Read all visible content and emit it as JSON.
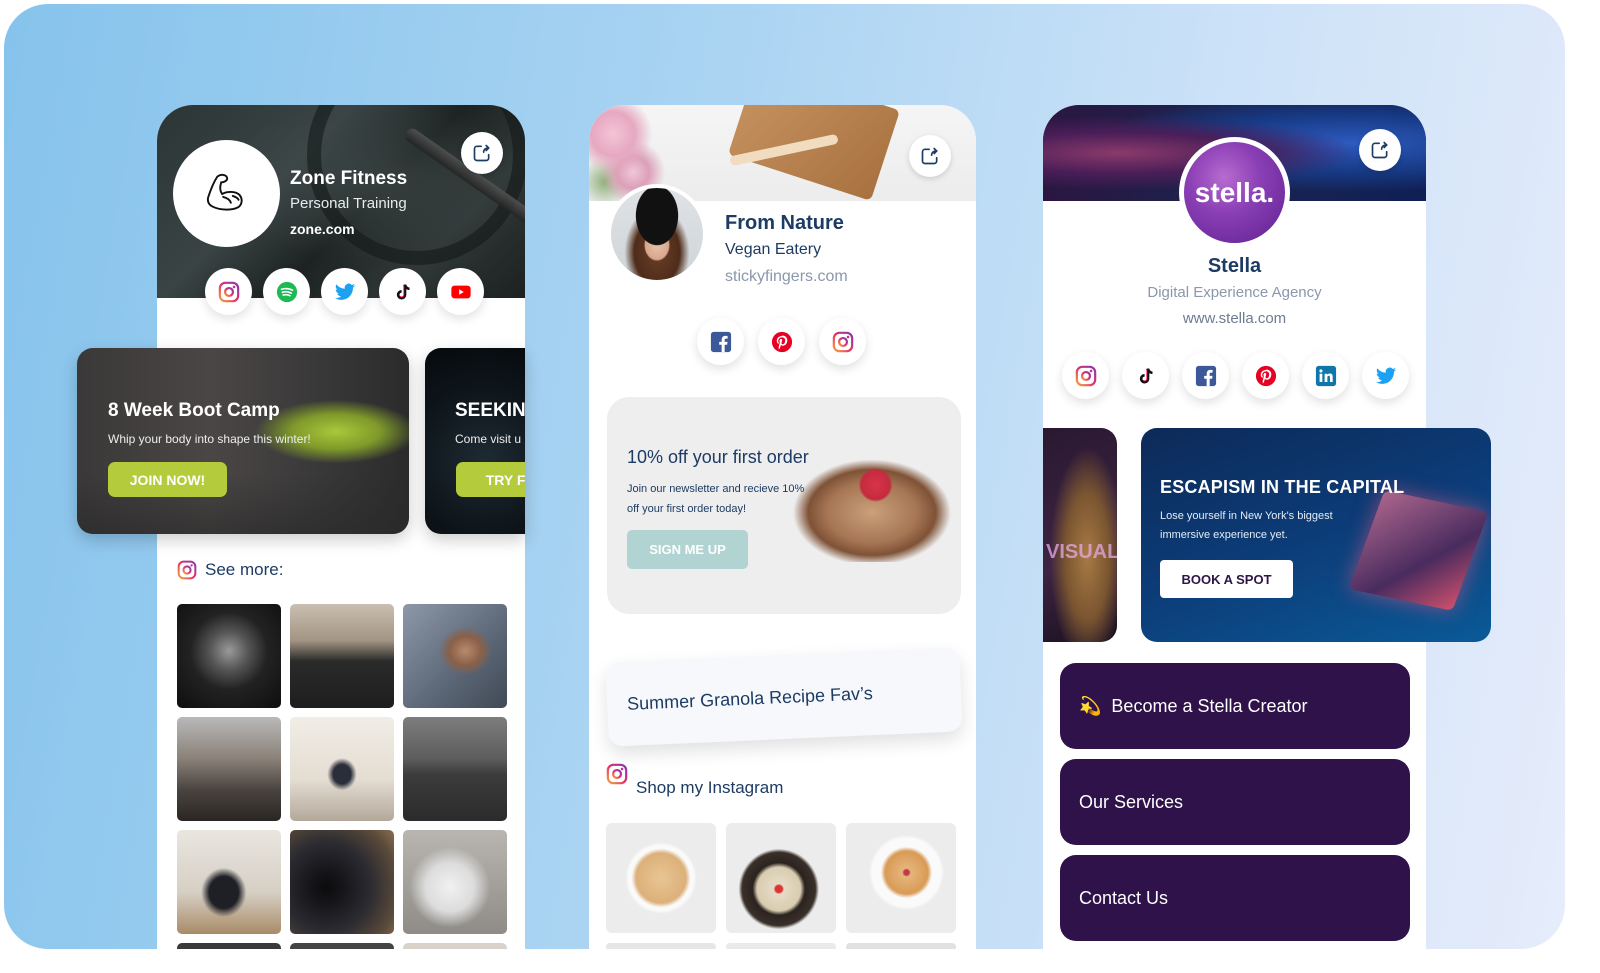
{
  "profiles": [
    {
      "name": "Zone Fitness",
      "subtitle": "Personal Training",
      "url": "zone.com",
      "avatar_icon": "flexed-bicep-icon",
      "socials": [
        "instagram",
        "spotify",
        "twitter",
        "tiktok",
        "youtube"
      ],
      "promos": [
        {
          "title": "8 Week Boot Camp",
          "description": "Whip your body into shape this winter!",
          "button": "JOIN NOW!"
        },
        {
          "title": "SEEKIN",
          "description": "Come visit u",
          "button": "TRY FO"
        }
      ],
      "gallery_heading": "See more:"
    },
    {
      "name": "From Nature",
      "subtitle": "Vegan Eatery",
      "url": "stickyfingers.com",
      "socials": [
        "facebook",
        "pinterest",
        "instagram"
      ],
      "promo": {
        "title": "10% off your first order",
        "description": "Join our newsletter and recieve 10% off your first order today!",
        "button": "SIGN ME UP"
      },
      "link": "Summer Granola Recipe Fav’s",
      "gallery_heading": "Shop my Instagram"
    },
    {
      "name": "Stella",
      "logo_text": "stella.",
      "subtitle": "Digital Experience Agency",
      "url": "www.stella.com",
      "socials": [
        "instagram",
        "tiktok",
        "facebook",
        "pinterest",
        "linkedin",
        "twitter"
      ],
      "promos": [
        {
          "partial_text": "VISUALS"
        },
        {
          "title": "ESCAPISM IN THE CAPITAL",
          "description": "Lose yourself in New York's biggest immersive experience yet.",
          "button": "BOOK A SPOT"
        }
      ],
      "links": [
        {
          "icon": "💫",
          "label": "Become a Stella Creator"
        },
        {
          "label": "Our Services"
        },
        {
          "label": "Contact Us"
        }
      ]
    }
  ],
  "colors": {
    "heading_navy": "#1d3b63",
    "lime": "#b4cc3c",
    "teal": "#b1d3d1",
    "stella_purple": "#2f1249"
  }
}
